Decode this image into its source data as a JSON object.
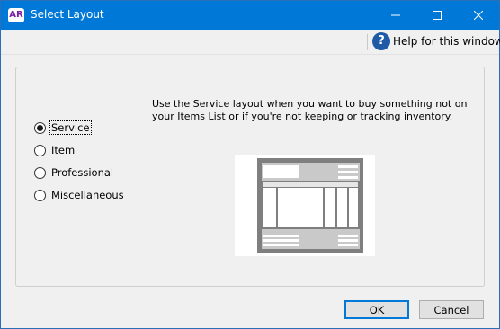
{
  "window": {
    "title": "Select Layout",
    "app_icon_text": "AR",
    "controls": [
      "minimize-icon",
      "maximize-icon",
      "close-icon"
    ]
  },
  "help": {
    "label": "Help for this window",
    "icon": "question-circle-icon",
    "icon_glyph": "?"
  },
  "layout_options": [
    {
      "label": "Service",
      "selected": true
    },
    {
      "label": "Item",
      "selected": false
    },
    {
      "label": "Professional",
      "selected": false
    },
    {
      "label": "Miscellaneous",
      "selected": false
    }
  ],
  "description": "Use the Service layout when you want to buy something not on your Items List or if you're not keeping or tracking inventory.",
  "buttons": {
    "ok": "OK",
    "cancel": "Cancel"
  },
  "colors": {
    "titlebar": "#0078d7",
    "help_icon": "#1f5aa6",
    "illustration_frame": "#7f7f7f"
  }
}
